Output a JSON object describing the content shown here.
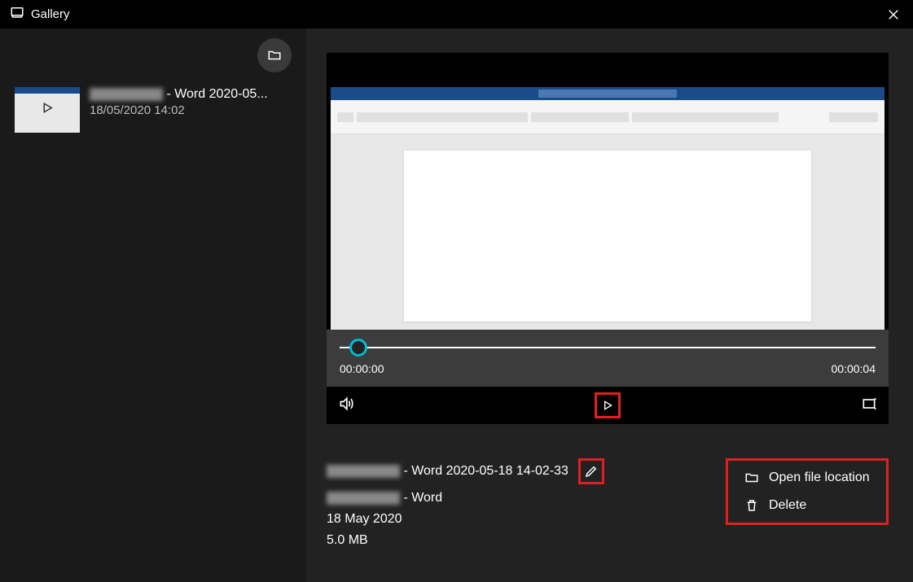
{
  "header": {
    "title": "Gallery"
  },
  "sidebar": {
    "item": {
      "title_suffix": " - Word 2020-05...",
      "date": "18/05/2020 14:02"
    }
  },
  "player": {
    "current_time": "00:00:00",
    "duration": "00:00:04"
  },
  "meta": {
    "filename_suffix": " - Word 2020-05-18 14-02-33",
    "app_suffix": " - Word",
    "date": "18 May 2020",
    "size": "5.0 MB"
  },
  "actions": {
    "open_location": "Open file location",
    "delete": "Delete"
  }
}
